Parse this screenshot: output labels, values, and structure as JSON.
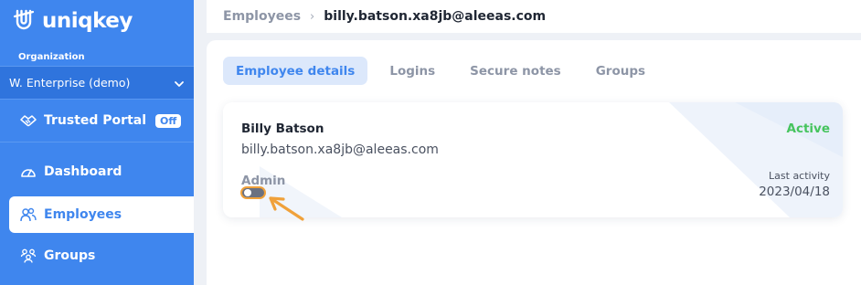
{
  "brand": {
    "name": "uniqkey",
    "logo_icon": "uniqkey-logo-icon"
  },
  "sidebar": {
    "org_label": "Organization",
    "org_value": "W. Enterprise (demo)",
    "items": [
      {
        "label": "Trusted Portal",
        "icon": "handshake-icon",
        "badge": "Off"
      },
      {
        "label": "Dashboard",
        "icon": "gauge-icon"
      },
      {
        "label": "Employees",
        "icon": "users-icon",
        "active": true
      },
      {
        "label": "Groups",
        "icon": "user-group-icon"
      }
    ]
  },
  "breadcrumb": {
    "parent": "Employees",
    "separator": "›",
    "current": "billy.batson.xa8jb@aleeas.com"
  },
  "tabs": [
    {
      "label": "Employee details",
      "active": true
    },
    {
      "label": "Logins"
    },
    {
      "label": "Secure notes"
    },
    {
      "label": "Groups"
    }
  ],
  "employee": {
    "name": "Billy Batson",
    "email": "billy.batson.xa8jb@aleeas.com",
    "role_label": "Admin",
    "admin_enabled": false,
    "status": "Active",
    "last_activity_label": "Last activity",
    "last_activity_value": "2023/04/18"
  },
  "colors": {
    "brand_blue": "#3f86ee",
    "active_green": "#46c45e",
    "highlight_orange": "#f0a13a"
  }
}
